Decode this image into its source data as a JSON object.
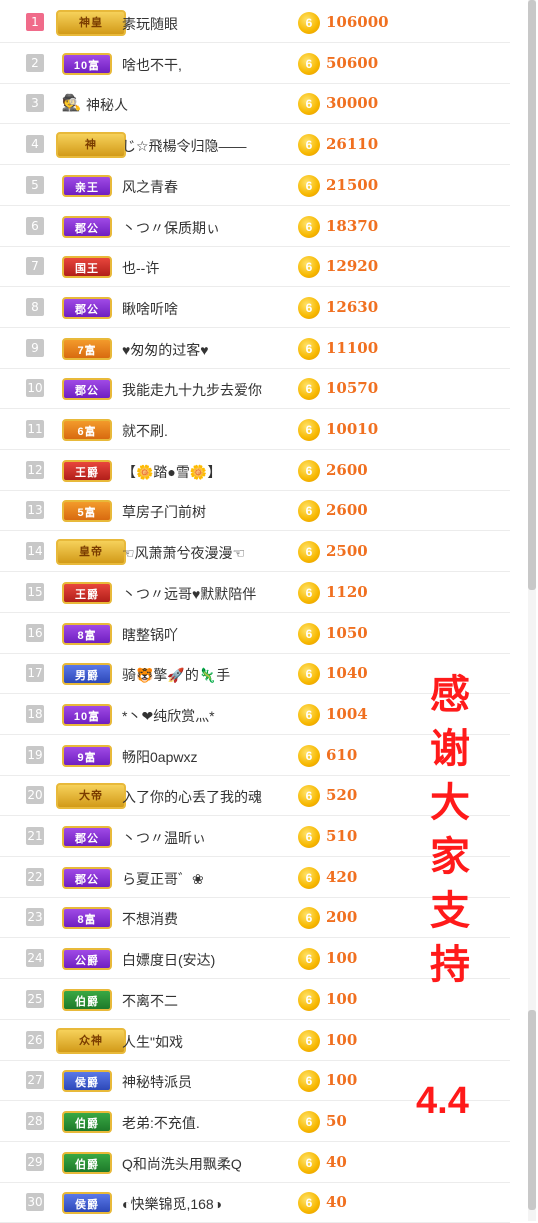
{
  "colors": {
    "accent": "#f07020",
    "thanks": "#ff1a1a",
    "coin": "#f7b800"
  },
  "coin_icon": "6",
  "rows": [
    {
      "rank": "1",
      "badge": "神皇",
      "badge_style": "gold",
      "name": "素玩随眼",
      "amount": "106000"
    },
    {
      "rank": "2",
      "badge": "10富",
      "badge_style": "purple",
      "name": "啥也不干,",
      "amount": "50600"
    },
    {
      "rank": "3",
      "badge": "",
      "badge_style": "none",
      "name": "神秘人",
      "amount": "30000"
    },
    {
      "rank": "4",
      "badge": "神",
      "badge_style": "gold",
      "name": "じ☆飛楊令归隐——",
      "amount": "26110"
    },
    {
      "rank": "5",
      "badge": "亲王",
      "badge_style": "purple",
      "name": "风之青春",
      "amount": "21500"
    },
    {
      "rank": "6",
      "badge": "郡公",
      "badge_style": "purple",
      "name": "丶つ〃保质期ぃ",
      "amount": "18370"
    },
    {
      "rank": "7",
      "badge": "国王",
      "badge_style": "red",
      "name": "也--许",
      "amount": "12920"
    },
    {
      "rank": "8",
      "badge": "郡公",
      "badge_style": "purple",
      "name": "瞅啥听啥",
      "amount": "12630"
    },
    {
      "rank": "9",
      "badge": "7富",
      "badge_style": "orange",
      "name": "♥匆匆的过客♥",
      "amount": "11100"
    },
    {
      "rank": "10",
      "badge": "郡公",
      "badge_style": "purple",
      "name": "我能走九十九步去爱你",
      "amount": "10570"
    },
    {
      "rank": "11",
      "badge": "6富",
      "badge_style": "orange",
      "name": "就不刷.",
      "amount": "10010"
    },
    {
      "rank": "12",
      "badge": "王爵",
      "badge_style": "red",
      "name": "【🌼踏●雪🌼】",
      "amount": "2600"
    },
    {
      "rank": "13",
      "badge": "5富",
      "badge_style": "orange",
      "name": "草房子门前树",
      "amount": "2600"
    },
    {
      "rank": "14",
      "badge": "皇帝",
      "badge_style": "gold",
      "name": "☜风萧萧兮夜漫漫☜",
      "amount": "2500"
    },
    {
      "rank": "15",
      "badge": "王爵",
      "badge_style": "red",
      "name": "丶つ〃远哥♥默默陪伴",
      "amount": "1120"
    },
    {
      "rank": "16",
      "badge": "8富",
      "badge_style": "purple",
      "name": "瞎整锅吖",
      "amount": "1050"
    },
    {
      "rank": "17",
      "badge": "男爵",
      "badge_style": "blue",
      "name": "骑🐯擎🚀的🦎手",
      "amount": "1040"
    },
    {
      "rank": "18",
      "badge": "10富",
      "badge_style": "purple",
      "name": "*丶❤纯欣赏灬*",
      "amount": "1004"
    },
    {
      "rank": "19",
      "badge": "9富",
      "badge_style": "purple",
      "name": "畅阳0apwxz",
      "amount": "610"
    },
    {
      "rank": "20",
      "badge": "大帝",
      "badge_style": "gold",
      "name": "入了你的心丢了我的魂",
      "amount": "520"
    },
    {
      "rank": "21",
      "badge": "郡公",
      "badge_style": "purple",
      "name": "丶つ〃温昕ぃ",
      "amount": "510"
    },
    {
      "rank": "22",
      "badge": "郡公",
      "badge_style": "purple",
      "name": "ら夏正哥゛❀",
      "amount": "420"
    },
    {
      "rank": "23",
      "badge": "8富",
      "badge_style": "purple",
      "name": "不想消费",
      "amount": "200"
    },
    {
      "rank": "24",
      "badge": "公爵",
      "badge_style": "purple",
      "name": "白嫖度日(安达)",
      "amount": "100"
    },
    {
      "rank": "25",
      "badge": "伯爵",
      "badge_style": "green",
      "name": "不离不二",
      "amount": "100"
    },
    {
      "rank": "26",
      "badge": "众神",
      "badge_style": "gold",
      "name": "人生\"如戏",
      "amount": "100"
    },
    {
      "rank": "27",
      "badge": "侯爵",
      "badge_style": "blue",
      "name": "神秘特派员",
      "amount": "100"
    },
    {
      "rank": "28",
      "badge": "伯爵",
      "badge_style": "green",
      "name": "老弟:不充值.",
      "amount": "50"
    },
    {
      "rank": "29",
      "badge": "伯爵",
      "badge_style": "green",
      "name": "Q和尚洗头用飘柔Q",
      "amount": "40"
    },
    {
      "rank": "30",
      "badge": "侯爵",
      "badge_style": "blue",
      "name": "◐快樂锦觅,168◑",
      "amount": "40"
    }
  ],
  "thanks_chars": [
    "感",
    "谢",
    "大",
    "家",
    "支",
    "持"
  ],
  "date": "4.4"
}
